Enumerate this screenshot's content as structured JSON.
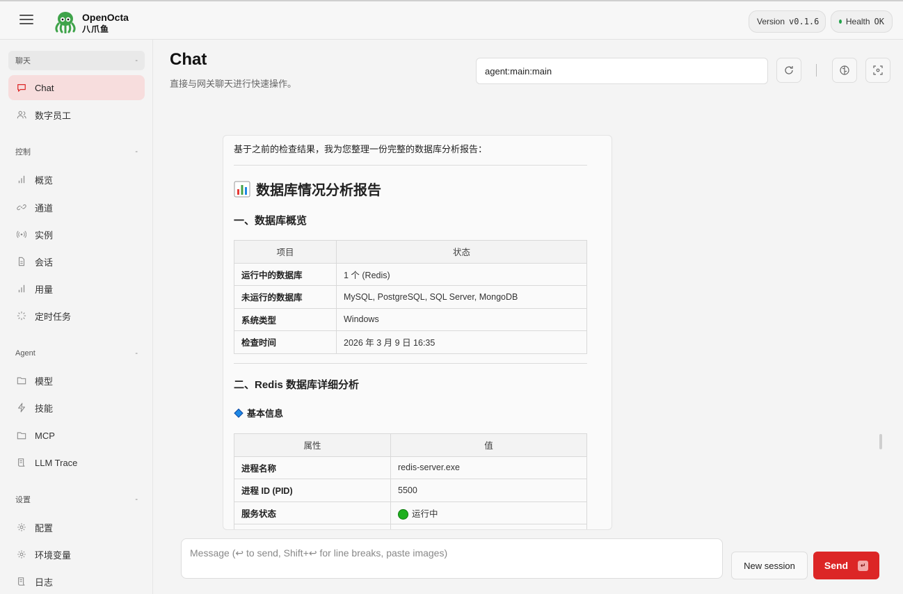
{
  "brand": {
    "name": "OpenOcta",
    "sub": "八爪鱼"
  },
  "header": {
    "version_label": "Version",
    "version_value": "v0.1.6",
    "health_label": "Health",
    "health_value": "OK",
    "health_color": "#22a34a"
  },
  "sidebar": {
    "groups": [
      {
        "title": "聊天",
        "collapse": "-",
        "items": [
          {
            "label": "Chat",
            "icon": "chat-bubble-icon",
            "selected": true
          },
          {
            "label": "数字员工",
            "icon": "users-icon"
          }
        ]
      },
      {
        "title": "控制",
        "collapse": "-",
        "items": [
          {
            "label": "概览",
            "icon": "bar-chart-icon"
          },
          {
            "label": "通道",
            "icon": "link-icon"
          },
          {
            "label": "实例",
            "icon": "broadcast-icon"
          },
          {
            "label": "会话",
            "icon": "document-icon"
          },
          {
            "label": "用量",
            "icon": "bar-chart-icon"
          },
          {
            "label": "定时任务",
            "icon": "loader-icon"
          }
        ]
      },
      {
        "title": "Agent",
        "collapse": "-",
        "items": [
          {
            "label": "模型",
            "icon": "folder-icon"
          },
          {
            "label": "技能",
            "icon": "bolt-icon"
          },
          {
            "label": "MCP",
            "icon": "folder-icon"
          },
          {
            "label": "LLM Trace",
            "icon": "scroll-icon"
          }
        ]
      },
      {
        "title": "设置",
        "collapse": "-",
        "items": [
          {
            "label": "配置",
            "icon": "gear-icon"
          },
          {
            "label": "环境变量",
            "icon": "gear-icon"
          },
          {
            "label": "日志",
            "icon": "scroll-icon"
          }
        ]
      }
    ]
  },
  "main": {
    "title": "Chat",
    "subtitle": "直接与网关聊天进行快速操作。",
    "session_key": "agent:main:main"
  },
  "message": {
    "intro": "基于之前的检查结果，我为您整理一份完整的数据库分析报告：",
    "report_title": "数据库情况分析报告",
    "section1": "一、数据库概览",
    "table1": {
      "headers": [
        "项目",
        "状态"
      ],
      "rows": [
        [
          "运行中的数据库",
          "1 个 (Redis)"
        ],
        [
          "未运行的数据库",
          "MySQL, PostgreSQL, SQL Server, MongoDB"
        ],
        [
          "系统类型",
          "Windows"
        ],
        [
          "检查时间",
          "2026 年 3 月 9 日 16:35"
        ]
      ]
    },
    "section2": "二、Redis 数据库详细分析",
    "subsection": "基本信息",
    "table2": {
      "headers": [
        "属性",
        "值"
      ],
      "rows": [
        [
          "进程名称",
          "redis-server.exe"
        ],
        [
          "进程 ID (PID)",
          "5500"
        ],
        [
          "服务状态",
          "运行中"
        ]
      ]
    }
  },
  "compose": {
    "placeholder": "Message (↩ to send, Shift+↩ for line breaks, paste images)",
    "new_session": "New session",
    "send": "Send",
    "send_kbd": "↵",
    "accent": "#dc2626"
  }
}
